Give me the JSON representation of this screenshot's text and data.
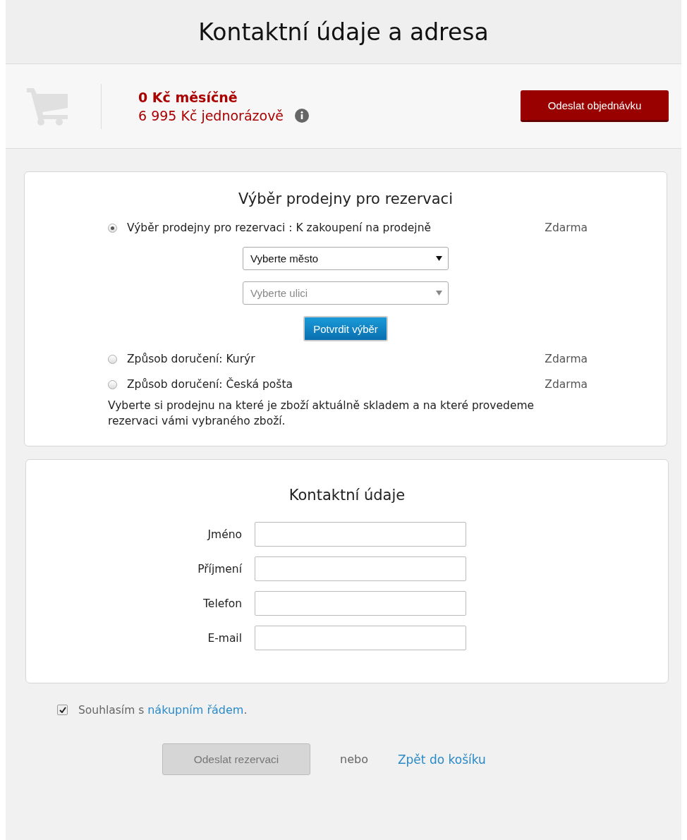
{
  "page_title": "Kontaktní údaje a adresa",
  "summary": {
    "monthly": "0 Kč měsíčně",
    "one_time": "6 995 Kč jednorázově",
    "order_button": "Odeslat objednávku"
  },
  "store_section": {
    "title": "Výběr prodejny pro rezervaci",
    "options": [
      {
        "label": "Výběr prodejny pro rezervaci : K zakoupení na prodejně",
        "price": "Zdarma",
        "selected": true
      },
      {
        "label": "Způsob doručení: Kurýr",
        "price": "Zdarma",
        "selected": false
      },
      {
        "label": "Způsob doručení: Česká pošta",
        "price": "Zdarma",
        "selected": false
      }
    ],
    "selects": [
      {
        "value": "Vyberte město",
        "disabled": false
      },
      {
        "value": "Vyberte ulici",
        "disabled": true
      }
    ],
    "confirm_button": "Potvrdit výběr",
    "note": "Vyberte si prodejnu na které je zboží aktuálně skladem a na které provedeme rezervaci vámi vybraného zboží."
  },
  "contact_section": {
    "title": "Kontaktní údaje",
    "fields": [
      {
        "label": "Jméno"
      },
      {
        "label": "Příjmení"
      },
      {
        "label": "Telefon"
      },
      {
        "label": "E-mail"
      }
    ]
  },
  "consent": {
    "checked": true,
    "text": "Souhlasím s",
    "link": "nákupním řádem",
    "after": "."
  },
  "footer": {
    "submit_button": "Odeslat rezervaci",
    "submit_disabled": true,
    "separator": "nebo",
    "back_link": "Zpět do košíku"
  }
}
